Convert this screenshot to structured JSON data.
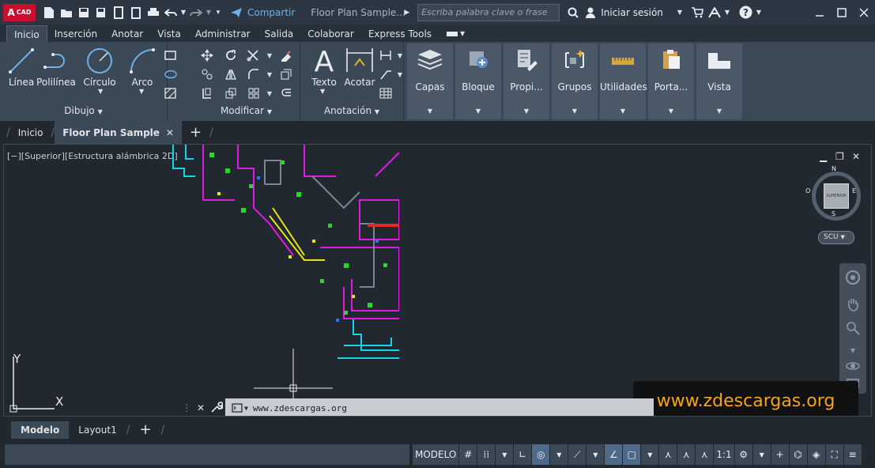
{
  "app": {
    "logo_main": "A",
    "logo_sub": "CAD",
    "share_label": "Compartir",
    "document_title": "Floor Plan Sample...",
    "search_placeholder": "Escriba palabra clave o frase",
    "sign_in_label": "Iniciar sesión"
  },
  "ribbon_tabs": [
    "Inicio",
    "Inserción",
    "Anotar",
    "Vista",
    "Administrar",
    "Salida",
    "Colaborar",
    "Express Tools"
  ],
  "ribbon": {
    "draw": {
      "title": "Dibujo",
      "tools": [
        "Línea",
        "Polilínea",
        "Círculo",
        "Arco"
      ]
    },
    "modify": {
      "title": "Modificar"
    },
    "annotation": {
      "title": "Anotación",
      "tools": [
        "Texto",
        "Acotar"
      ]
    },
    "panels": [
      "Capas",
      "Bloque",
      "Propi...",
      "Grupos",
      "Utilidades",
      "Porta...",
      "Vista"
    ]
  },
  "doc_tabs": {
    "home": "Inicio",
    "active": "Floor Plan Sample"
  },
  "viewport": {
    "label": "[−][Superior][Estructura alámbrica 2D]",
    "compass": {
      "n": "N",
      "s": "S",
      "e": "E",
      "w": "O",
      "cube": "SUPERIOR"
    },
    "ucs": "SCU",
    "axis_x": "X",
    "axis_y": "Y"
  },
  "command_line": {
    "text": "www.zdescargas.org"
  },
  "watermark": "www.zdescargas.org",
  "layout_tabs": [
    "Modelo",
    "Layout1"
  ],
  "status": {
    "model": "MODELO",
    "scale": "1:1"
  },
  "colors": {
    "cyan": "#15d7ea",
    "magenta": "#e01ae0",
    "yellow": "#e6e61a",
    "green": "#22dd22",
    "accent": "#4e6a88"
  }
}
